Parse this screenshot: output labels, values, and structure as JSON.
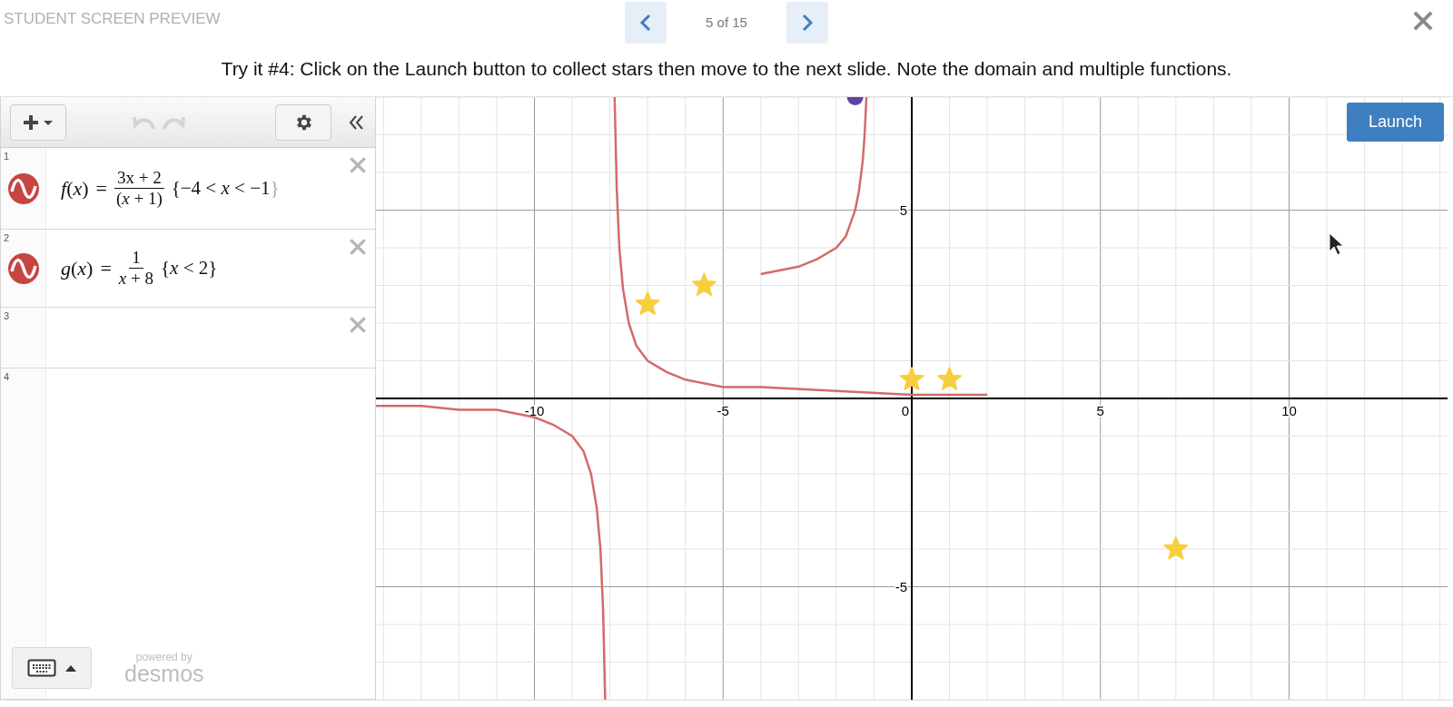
{
  "header": {
    "title": "STUDENT SCREEN PREVIEW",
    "pager": "5 of 15"
  },
  "instruction": "Try it #4: Click on the Launch button to collect stars then move to the next slide. Note the domain and multiple functions.",
  "expressions": [
    {
      "number": "1",
      "color": "#c74440",
      "lhs": "*f*(*x*)",
      "eq": "=",
      "numerator": "3x + 2",
      "denominator": "(*x* + 1)",
      "restriction": "{−4 < *x* < −1",
      "closing": "}",
      "closing_faint": true
    },
    {
      "number": "2",
      "color": "#c74440",
      "lhs": "*g*(*x*)",
      "eq": "=",
      "numerator": "1",
      "denominator": "*x* + 8",
      "restriction": "{*x* < 2",
      "closing": "}",
      "closing_faint": false
    },
    {
      "number": "3"
    },
    {
      "number": "4"
    }
  ],
  "branding": {
    "line1": "powered by",
    "line2": "desmos"
  },
  "graph": {
    "launch": "Launch",
    "chart_data": {
      "type": "line",
      "grid": true,
      "xlim": [
        -14.2,
        14.2
      ],
      "ylim": [
        -8,
        8
      ],
      "xticks": [
        -10,
        -5,
        0,
        5,
        10
      ],
      "yticks": [
        -5,
        5
      ],
      "series": [
        {
          "color": "#d46a6a",
          "x": [
            -4,
            -3,
            -2.5,
            -2,
            -1.75,
            -1.5,
            -1.4,
            -1.3,
            -1.25,
            -1.2
          ],
          "values": [
            3.3,
            3.5,
            3.7,
            4,
            4.3,
            5,
            5.5,
            6.3,
            7,
            8
          ]
        },
        {
          "color": "#d46a6a",
          "x": [
            -14.2,
            -13,
            -12,
            -11,
            -10,
            -9.5,
            -9,
            -8.7,
            -8.5,
            -8.35,
            -8.25,
            -8.18,
            -8.125,
            -8,
            -7.875,
            -7.82,
            -7.75,
            -7.65,
            -7.5,
            -7.3,
            -7,
            -6.5,
            -6,
            -5,
            -4,
            -2,
            0,
            2
          ],
          "values": [
            -0.2,
            -0.2,
            -0.3,
            -0.3,
            -0.5,
            -0.7,
            -1,
            -1.4,
            -2,
            -2.9,
            -4,
            -5.6,
            -8,
            null,
            8,
            5.6,
            4,
            2.9,
            2,
            1.4,
            1,
            0.7,
            0.5,
            0.3,
            0.3,
            0.2,
            0.1,
            0.1
          ]
        },
        {
          "color": "#f7cf3d",
          "type": "scatter",
          "marker": "star",
          "x": [
            -7,
            -5.5,
            0,
            1,
            7
          ],
          "values": [
            2.5,
            3,
            0.5,
            0.5,
            -4
          ]
        },
        {
          "color": "#6042a6",
          "type": "scatter",
          "marker": "circle",
          "x": [
            -1.5
          ],
          "values": [
            8
          ]
        }
      ]
    }
  }
}
